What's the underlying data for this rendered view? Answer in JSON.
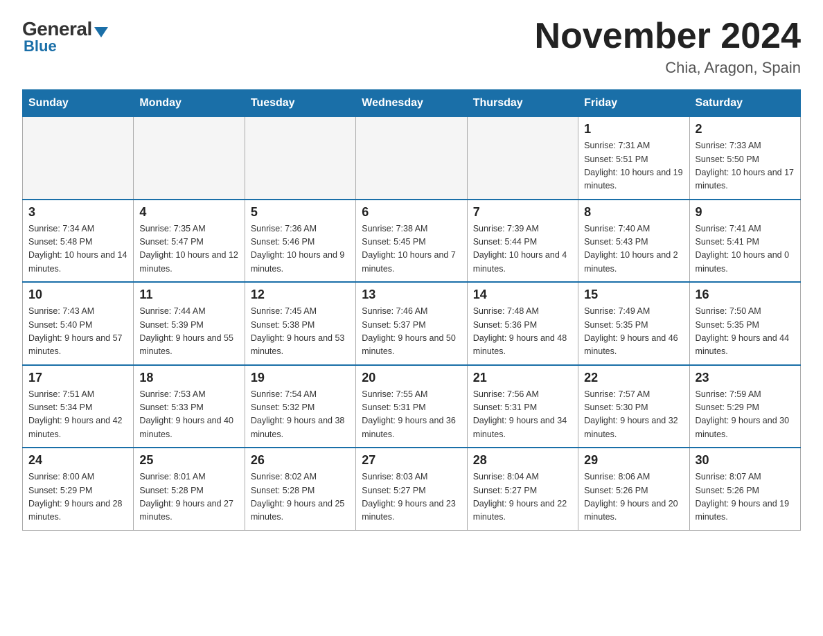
{
  "logo": {
    "general": "General",
    "arrow": "▼",
    "blue": "Blue"
  },
  "title": "November 2024",
  "subtitle": "Chia, Aragon, Spain",
  "days_header": [
    "Sunday",
    "Monday",
    "Tuesday",
    "Wednesday",
    "Thursday",
    "Friday",
    "Saturday"
  ],
  "weeks": [
    [
      {
        "day": "",
        "info": ""
      },
      {
        "day": "",
        "info": ""
      },
      {
        "day": "",
        "info": ""
      },
      {
        "day": "",
        "info": ""
      },
      {
        "day": "",
        "info": ""
      },
      {
        "day": "1",
        "info": "Sunrise: 7:31 AM\nSunset: 5:51 PM\nDaylight: 10 hours and 19 minutes."
      },
      {
        "day": "2",
        "info": "Sunrise: 7:33 AM\nSunset: 5:50 PM\nDaylight: 10 hours and 17 minutes."
      }
    ],
    [
      {
        "day": "3",
        "info": "Sunrise: 7:34 AM\nSunset: 5:48 PM\nDaylight: 10 hours and 14 minutes."
      },
      {
        "day": "4",
        "info": "Sunrise: 7:35 AM\nSunset: 5:47 PM\nDaylight: 10 hours and 12 minutes."
      },
      {
        "day": "5",
        "info": "Sunrise: 7:36 AM\nSunset: 5:46 PM\nDaylight: 10 hours and 9 minutes."
      },
      {
        "day": "6",
        "info": "Sunrise: 7:38 AM\nSunset: 5:45 PM\nDaylight: 10 hours and 7 minutes."
      },
      {
        "day": "7",
        "info": "Sunrise: 7:39 AM\nSunset: 5:44 PM\nDaylight: 10 hours and 4 minutes."
      },
      {
        "day": "8",
        "info": "Sunrise: 7:40 AM\nSunset: 5:43 PM\nDaylight: 10 hours and 2 minutes."
      },
      {
        "day": "9",
        "info": "Sunrise: 7:41 AM\nSunset: 5:41 PM\nDaylight: 10 hours and 0 minutes."
      }
    ],
    [
      {
        "day": "10",
        "info": "Sunrise: 7:43 AM\nSunset: 5:40 PM\nDaylight: 9 hours and 57 minutes."
      },
      {
        "day": "11",
        "info": "Sunrise: 7:44 AM\nSunset: 5:39 PM\nDaylight: 9 hours and 55 minutes."
      },
      {
        "day": "12",
        "info": "Sunrise: 7:45 AM\nSunset: 5:38 PM\nDaylight: 9 hours and 53 minutes."
      },
      {
        "day": "13",
        "info": "Sunrise: 7:46 AM\nSunset: 5:37 PM\nDaylight: 9 hours and 50 minutes."
      },
      {
        "day": "14",
        "info": "Sunrise: 7:48 AM\nSunset: 5:36 PM\nDaylight: 9 hours and 48 minutes."
      },
      {
        "day": "15",
        "info": "Sunrise: 7:49 AM\nSunset: 5:35 PM\nDaylight: 9 hours and 46 minutes."
      },
      {
        "day": "16",
        "info": "Sunrise: 7:50 AM\nSunset: 5:35 PM\nDaylight: 9 hours and 44 minutes."
      }
    ],
    [
      {
        "day": "17",
        "info": "Sunrise: 7:51 AM\nSunset: 5:34 PM\nDaylight: 9 hours and 42 minutes."
      },
      {
        "day": "18",
        "info": "Sunrise: 7:53 AM\nSunset: 5:33 PM\nDaylight: 9 hours and 40 minutes."
      },
      {
        "day": "19",
        "info": "Sunrise: 7:54 AM\nSunset: 5:32 PM\nDaylight: 9 hours and 38 minutes."
      },
      {
        "day": "20",
        "info": "Sunrise: 7:55 AM\nSunset: 5:31 PM\nDaylight: 9 hours and 36 minutes."
      },
      {
        "day": "21",
        "info": "Sunrise: 7:56 AM\nSunset: 5:31 PM\nDaylight: 9 hours and 34 minutes."
      },
      {
        "day": "22",
        "info": "Sunrise: 7:57 AM\nSunset: 5:30 PM\nDaylight: 9 hours and 32 minutes."
      },
      {
        "day": "23",
        "info": "Sunrise: 7:59 AM\nSunset: 5:29 PM\nDaylight: 9 hours and 30 minutes."
      }
    ],
    [
      {
        "day": "24",
        "info": "Sunrise: 8:00 AM\nSunset: 5:29 PM\nDaylight: 9 hours and 28 minutes."
      },
      {
        "day": "25",
        "info": "Sunrise: 8:01 AM\nSunset: 5:28 PM\nDaylight: 9 hours and 27 minutes."
      },
      {
        "day": "26",
        "info": "Sunrise: 8:02 AM\nSunset: 5:28 PM\nDaylight: 9 hours and 25 minutes."
      },
      {
        "day": "27",
        "info": "Sunrise: 8:03 AM\nSunset: 5:27 PM\nDaylight: 9 hours and 23 minutes."
      },
      {
        "day": "28",
        "info": "Sunrise: 8:04 AM\nSunset: 5:27 PM\nDaylight: 9 hours and 22 minutes."
      },
      {
        "day": "29",
        "info": "Sunrise: 8:06 AM\nSunset: 5:26 PM\nDaylight: 9 hours and 20 minutes."
      },
      {
        "day": "30",
        "info": "Sunrise: 8:07 AM\nSunset: 5:26 PM\nDaylight: 9 hours and 19 minutes."
      }
    ]
  ]
}
